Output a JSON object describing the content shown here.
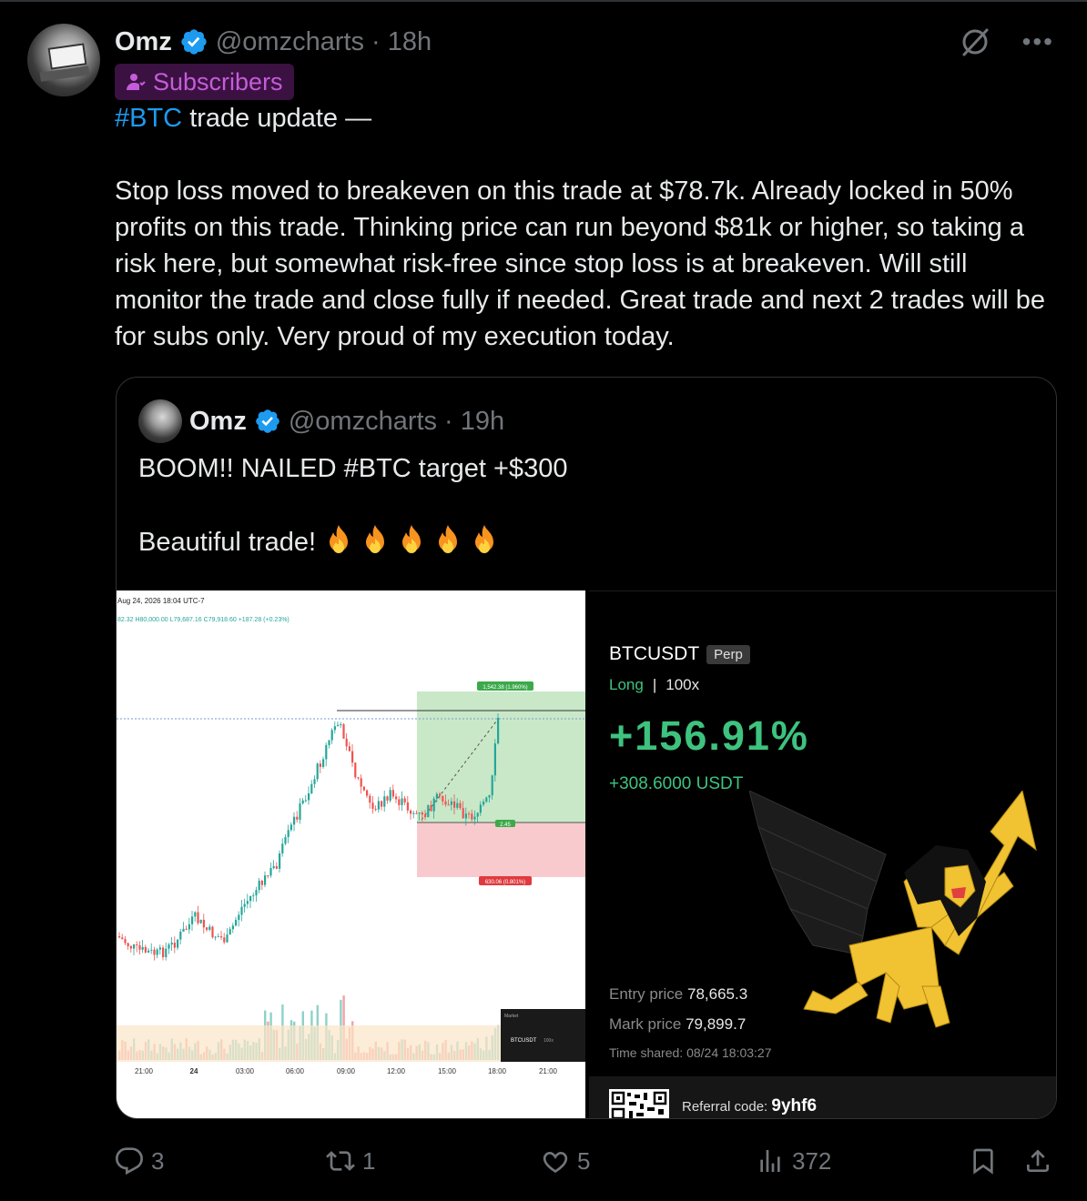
{
  "tweet": {
    "author_name": "Omz",
    "handle": "@omzcharts",
    "separator": "·",
    "time": "18h",
    "badge_label": "Subscribers",
    "text_hashtag": "#BTC",
    "text_line1_rest": " trade update —",
    "text_body": "Stop loss moved to breakeven on this trade at $78.7k. Already locked in 50% profits on this trade. Thinking price can run beyond $81k or higher, so taking a risk here, but somewhat risk-free since stop loss is at breakeven. Will still monitor the trade and close fully if needed. Great trade and next 2 trades will be for subs only. Very proud of my execution today."
  },
  "quote": {
    "author_name": "Omz",
    "handle": "@omzcharts",
    "separator": "·",
    "time": "19h",
    "line1": "BOOM!! NAILED #BTC target +$300",
    "line2": "Beautiful trade! "
  },
  "chart": {
    "date_label": "Aug 24, 2026 18:04 UTC-7",
    "ohlc_label": "82.32  H80,000.00  L79,687.16  C79,918.60  +187.28 (+0.23%)",
    "target_label": "1,542.38 (1.960%)",
    "entry_label": "2.45",
    "stop_label": "630.06 (0.801%)",
    "market_label": "Market",
    "symbol_label": "BTCUSDT",
    "lev_label": "100x",
    "x_ticks": [
      "21:00",
      "24",
      "03:00",
      "06:00",
      "09:00",
      "12:00",
      "15:00",
      "18:00",
      "21:00"
    ]
  },
  "card": {
    "pair": "BTCUSDT",
    "perp": "Perp",
    "side": "Long",
    "divider": "|",
    "leverage": "100x",
    "pnl_pct": "+156.91%",
    "pnl_usd": "+308.6000 USDT",
    "entry_label": "Entry price",
    "entry_value": "78,665.3",
    "mark_label": "Mark price",
    "mark_value": "79,899.7",
    "time_shared": "Time shared: 08/24 18:03:27",
    "ref_label": "Referral code: ",
    "ref_code": "9yhf6"
  },
  "actions": {
    "replies": "3",
    "reposts": "1",
    "likes": "5",
    "views": "372"
  },
  "colors": {
    "accent": "#1d9bf0",
    "subscriber": "#c45cd9",
    "profit_green": "#3ec37f",
    "muted": "#71767b"
  }
}
